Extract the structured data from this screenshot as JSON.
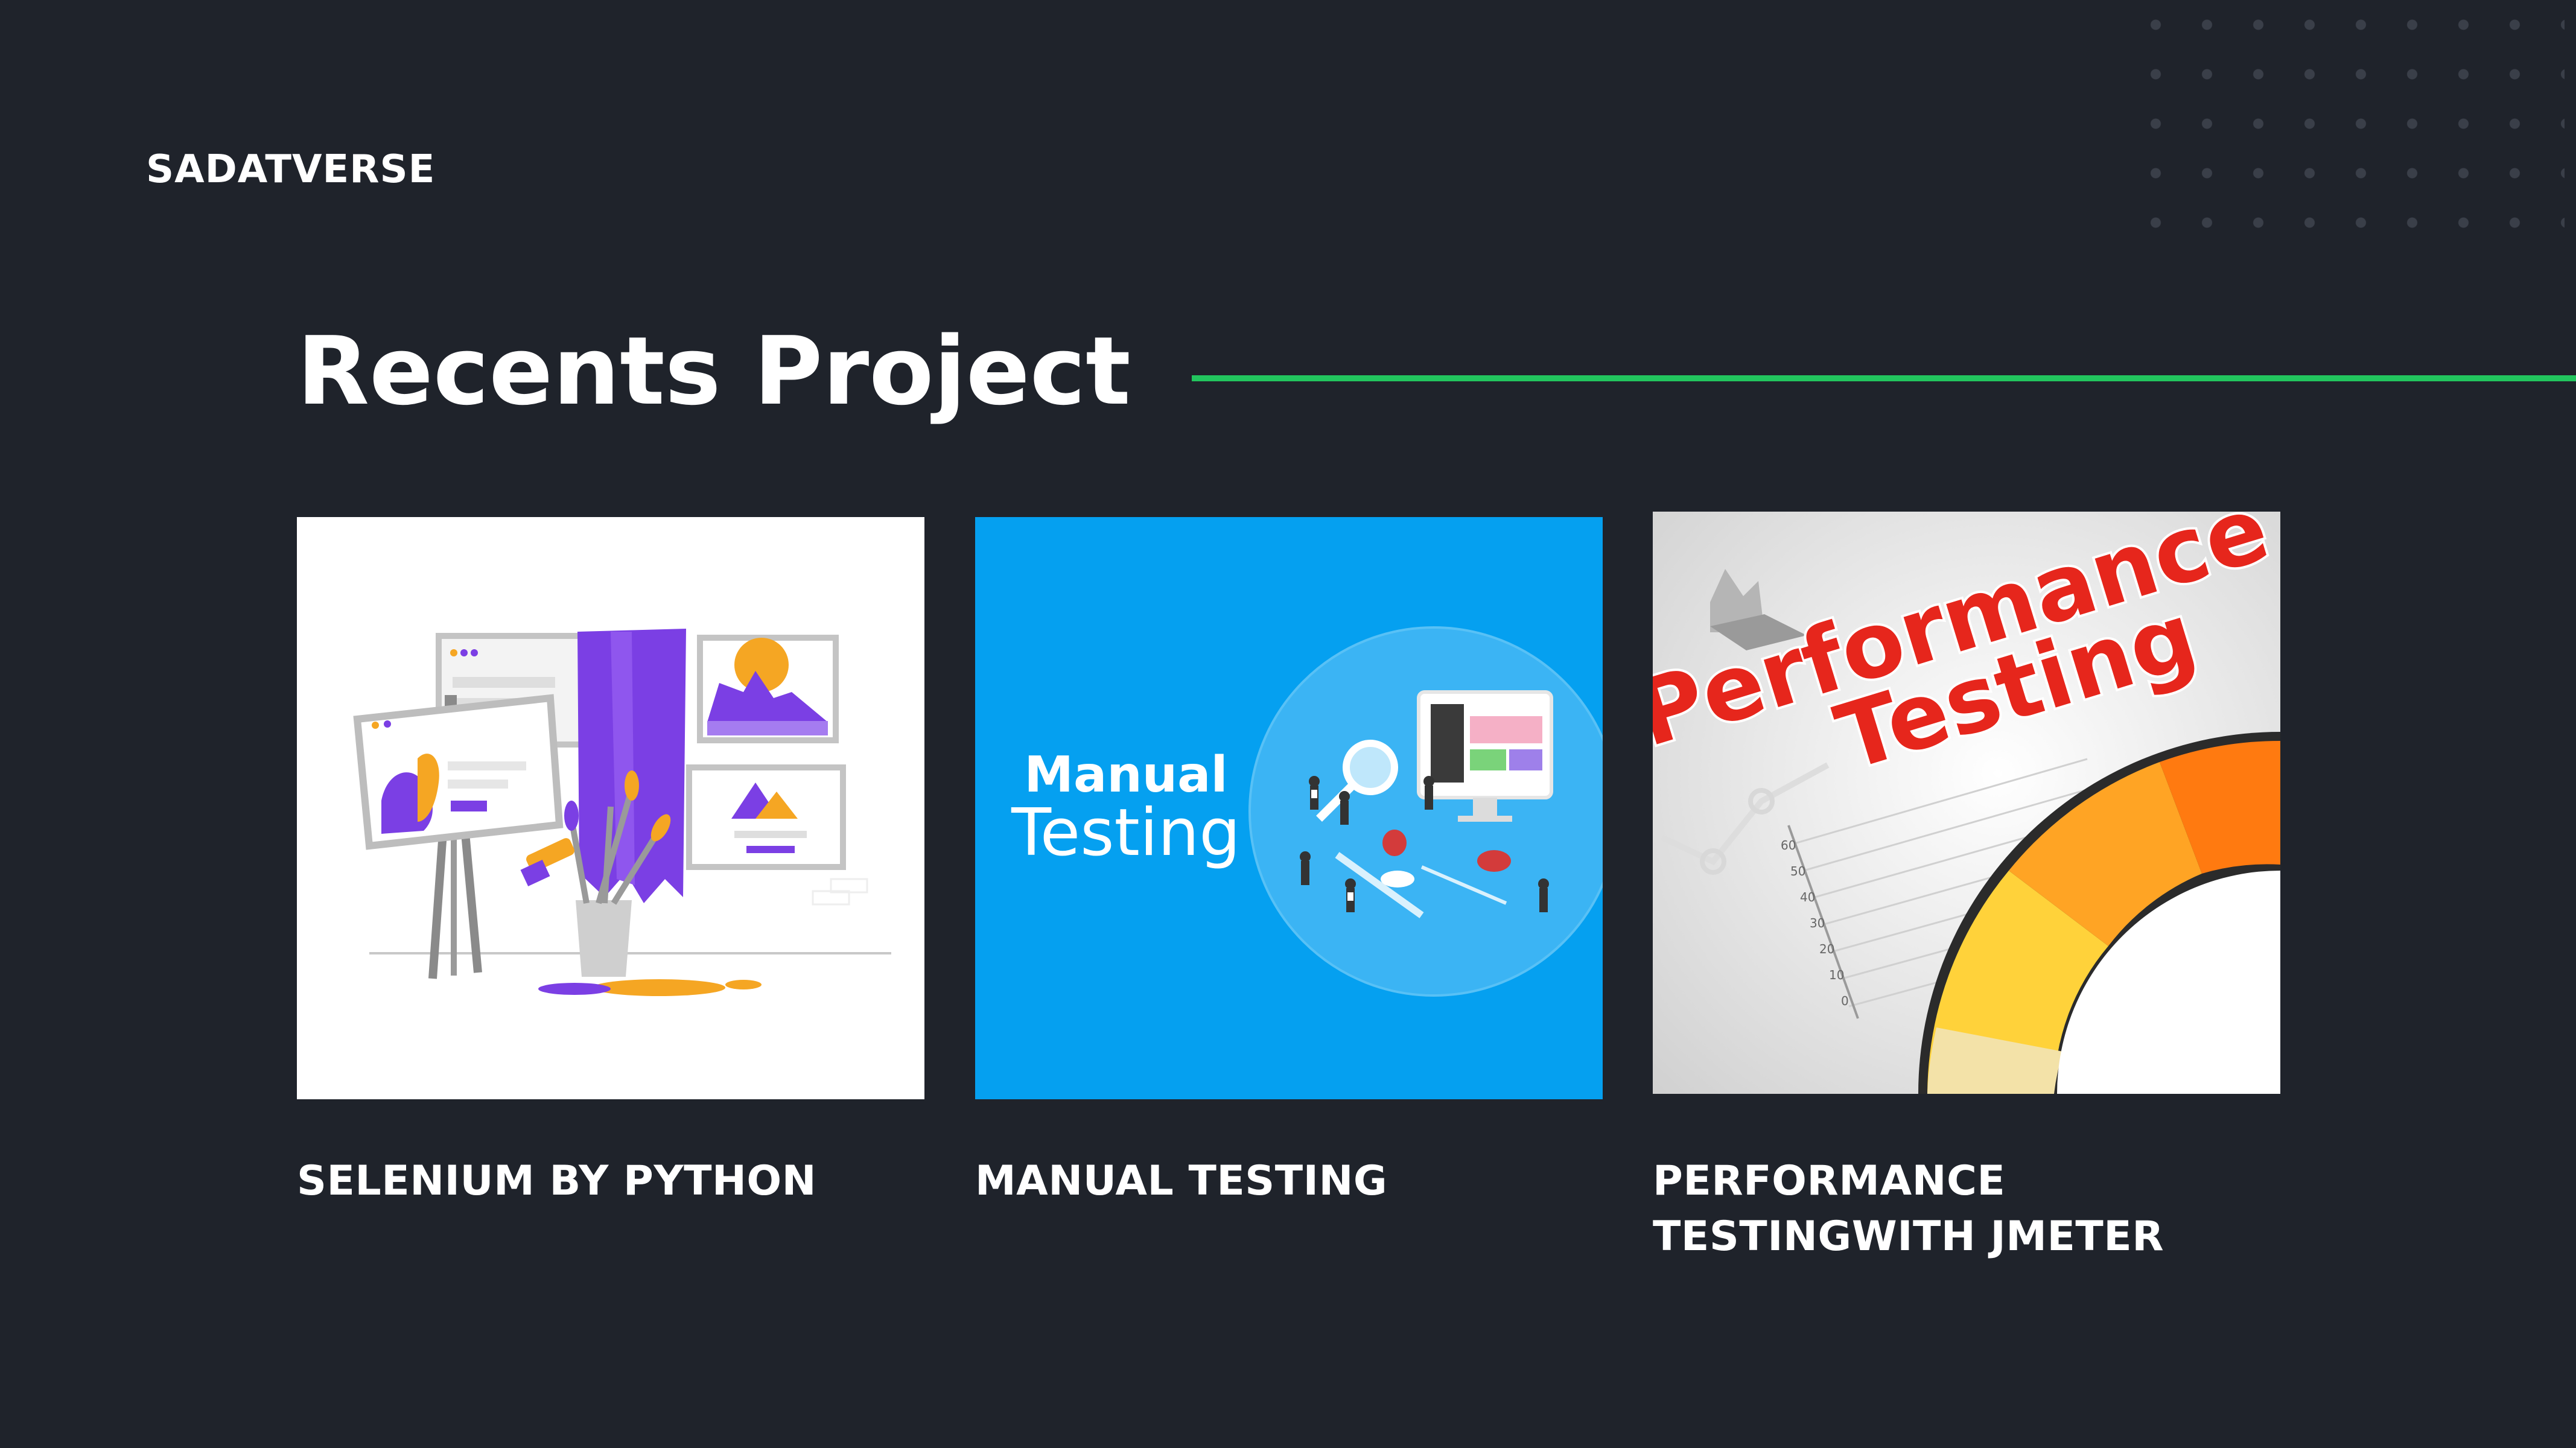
{
  "brand": {
    "name": "SADATVERSE"
  },
  "section": {
    "title": "Recents Project",
    "accent_color": "#22c55e"
  },
  "projects": [
    {
      "title": "SELENIUM BY PYTHON",
      "image_icon": "art-studio-illustration"
    },
    {
      "title": "MANUAL TESTING",
      "image_icon": "manual-testing-illustration",
      "image_text_line1": "Manual",
      "image_text_line2": "Testing"
    },
    {
      "title": "PERFORMANCE TESTINGWITH JMETER",
      "image_icon": "performance-testing-gauge",
      "image_text_line1": "Performance",
      "image_text_line2": "Testing",
      "gauge_scale": [
        "60",
        "50",
        "40",
        "30",
        "20",
        "10",
        "0"
      ]
    }
  ],
  "colors": {
    "background": "#1f232b",
    "manual_blue": "#05a0f0",
    "performance_red": "#e6261c"
  }
}
